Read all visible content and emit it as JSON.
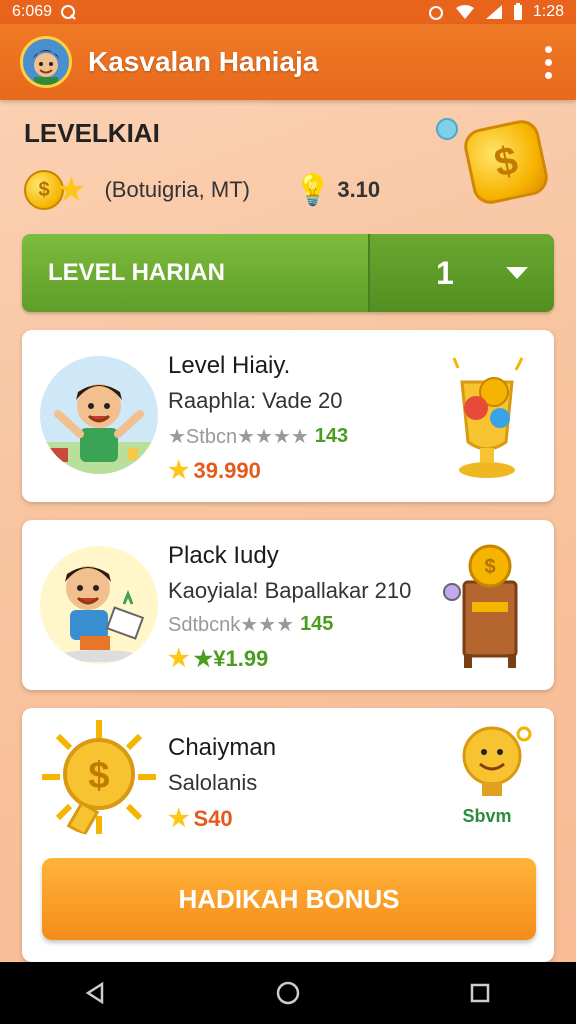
{
  "status_bar": {
    "left_text": "6:069",
    "time": "1:28"
  },
  "app_bar": {
    "title": "Kasvalan Haniaja"
  },
  "level": {
    "title": "LEVELKIAI",
    "meta": "(Botuigria, MT)",
    "points": "3.10"
  },
  "level_selector": {
    "label": "LEVEL HARIAN",
    "value": "1"
  },
  "cards": [
    {
      "title": "Level Hiaiy.",
      "subtitle": "Raaphla: Vade 20",
      "rating_text": "★Stbcn★★★★",
      "rating_score": "143",
      "price": "39.990"
    },
    {
      "title": "Plack Iudy",
      "subtitle": "Kaoyiala! Bapallakar 210",
      "rating_text": "Sdtbcnk★★★",
      "rating_score": "145",
      "price": "★¥1.99"
    },
    {
      "title": "Chaiyman",
      "subtitle": "Salolanis",
      "price": "S40",
      "reward_label": "Sbvm"
    }
  ],
  "bonus_button": {
    "label": "HADIKAH BONUS"
  },
  "colors": {
    "primary_orange": "#e8691c",
    "green": "#6aa832",
    "gold": "#f5b400",
    "price_orange": "#e35a1a",
    "price_green": "#4a9d1e"
  },
  "icons": [
    "wifi-icon",
    "signal-icon",
    "battery-icon",
    "menu-dots-icon",
    "coin-icon",
    "star-icon",
    "bulb-icon",
    "chevron-down-icon",
    "back-icon",
    "home-icon",
    "recents-icon"
  ]
}
